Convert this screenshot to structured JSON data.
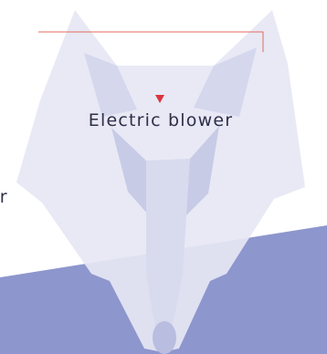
{
  "product_label": "Electric blower",
  "edge_label": "er",
  "colors": {
    "background": "#ffffff",
    "fox_light": "#e6e7f4",
    "fox_mid": "#d5d7ed",
    "fox_shadow": "#b9bddf",
    "bottom_band": "#8d96cd",
    "callout_line": "#e46a5b",
    "marker": "#d9363e",
    "text": "#2e2f48"
  }
}
